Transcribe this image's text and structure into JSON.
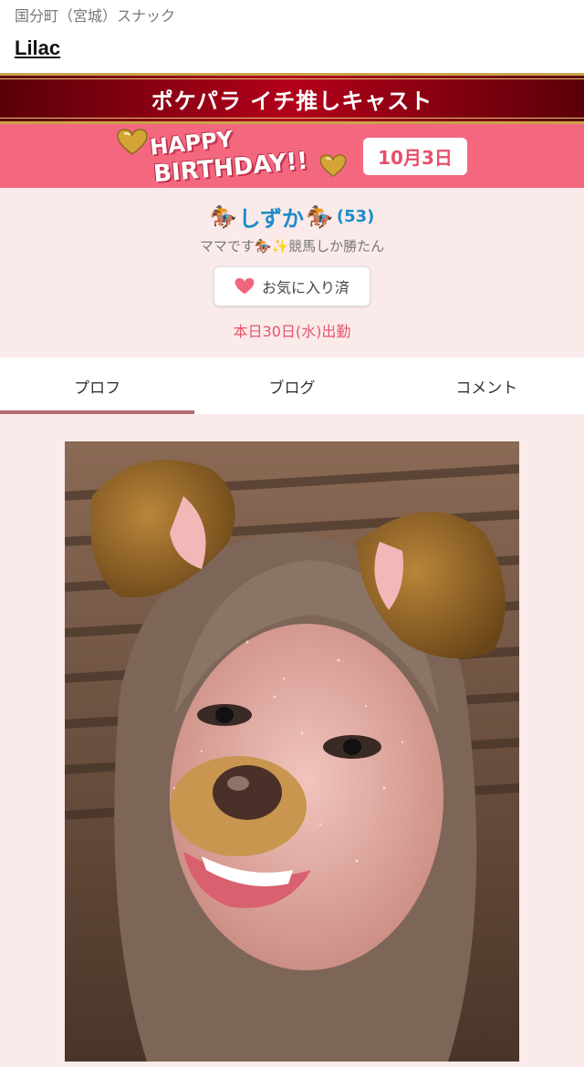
{
  "header": {
    "area": "国分町（宮城）スナック",
    "shop_name": "Lilac"
  },
  "banner": {
    "title": "ポケパラ イチ推しキャスト"
  },
  "birthday": {
    "line1": "HAPPY",
    "line2": "BIRTHDAY!!",
    "date": "10月3日"
  },
  "profile": {
    "emoji_left": "🏇",
    "name": "しずか",
    "emoji_right": "🏇",
    "age": "(53)",
    "catchphrase": "ママです🏇✨競馬しか勝たん",
    "favorite_label": "お気に入り済",
    "shift": "本日30日(水)出勤"
  },
  "tabs": [
    {
      "label": "プロフ"
    },
    {
      "label": "ブログ"
    },
    {
      "label": "コメント"
    }
  ],
  "colors": {
    "accent": "#f4687f",
    "name": "#1c8cc9",
    "banner": "#b3001a",
    "tab_indicator": "#b06a74"
  }
}
